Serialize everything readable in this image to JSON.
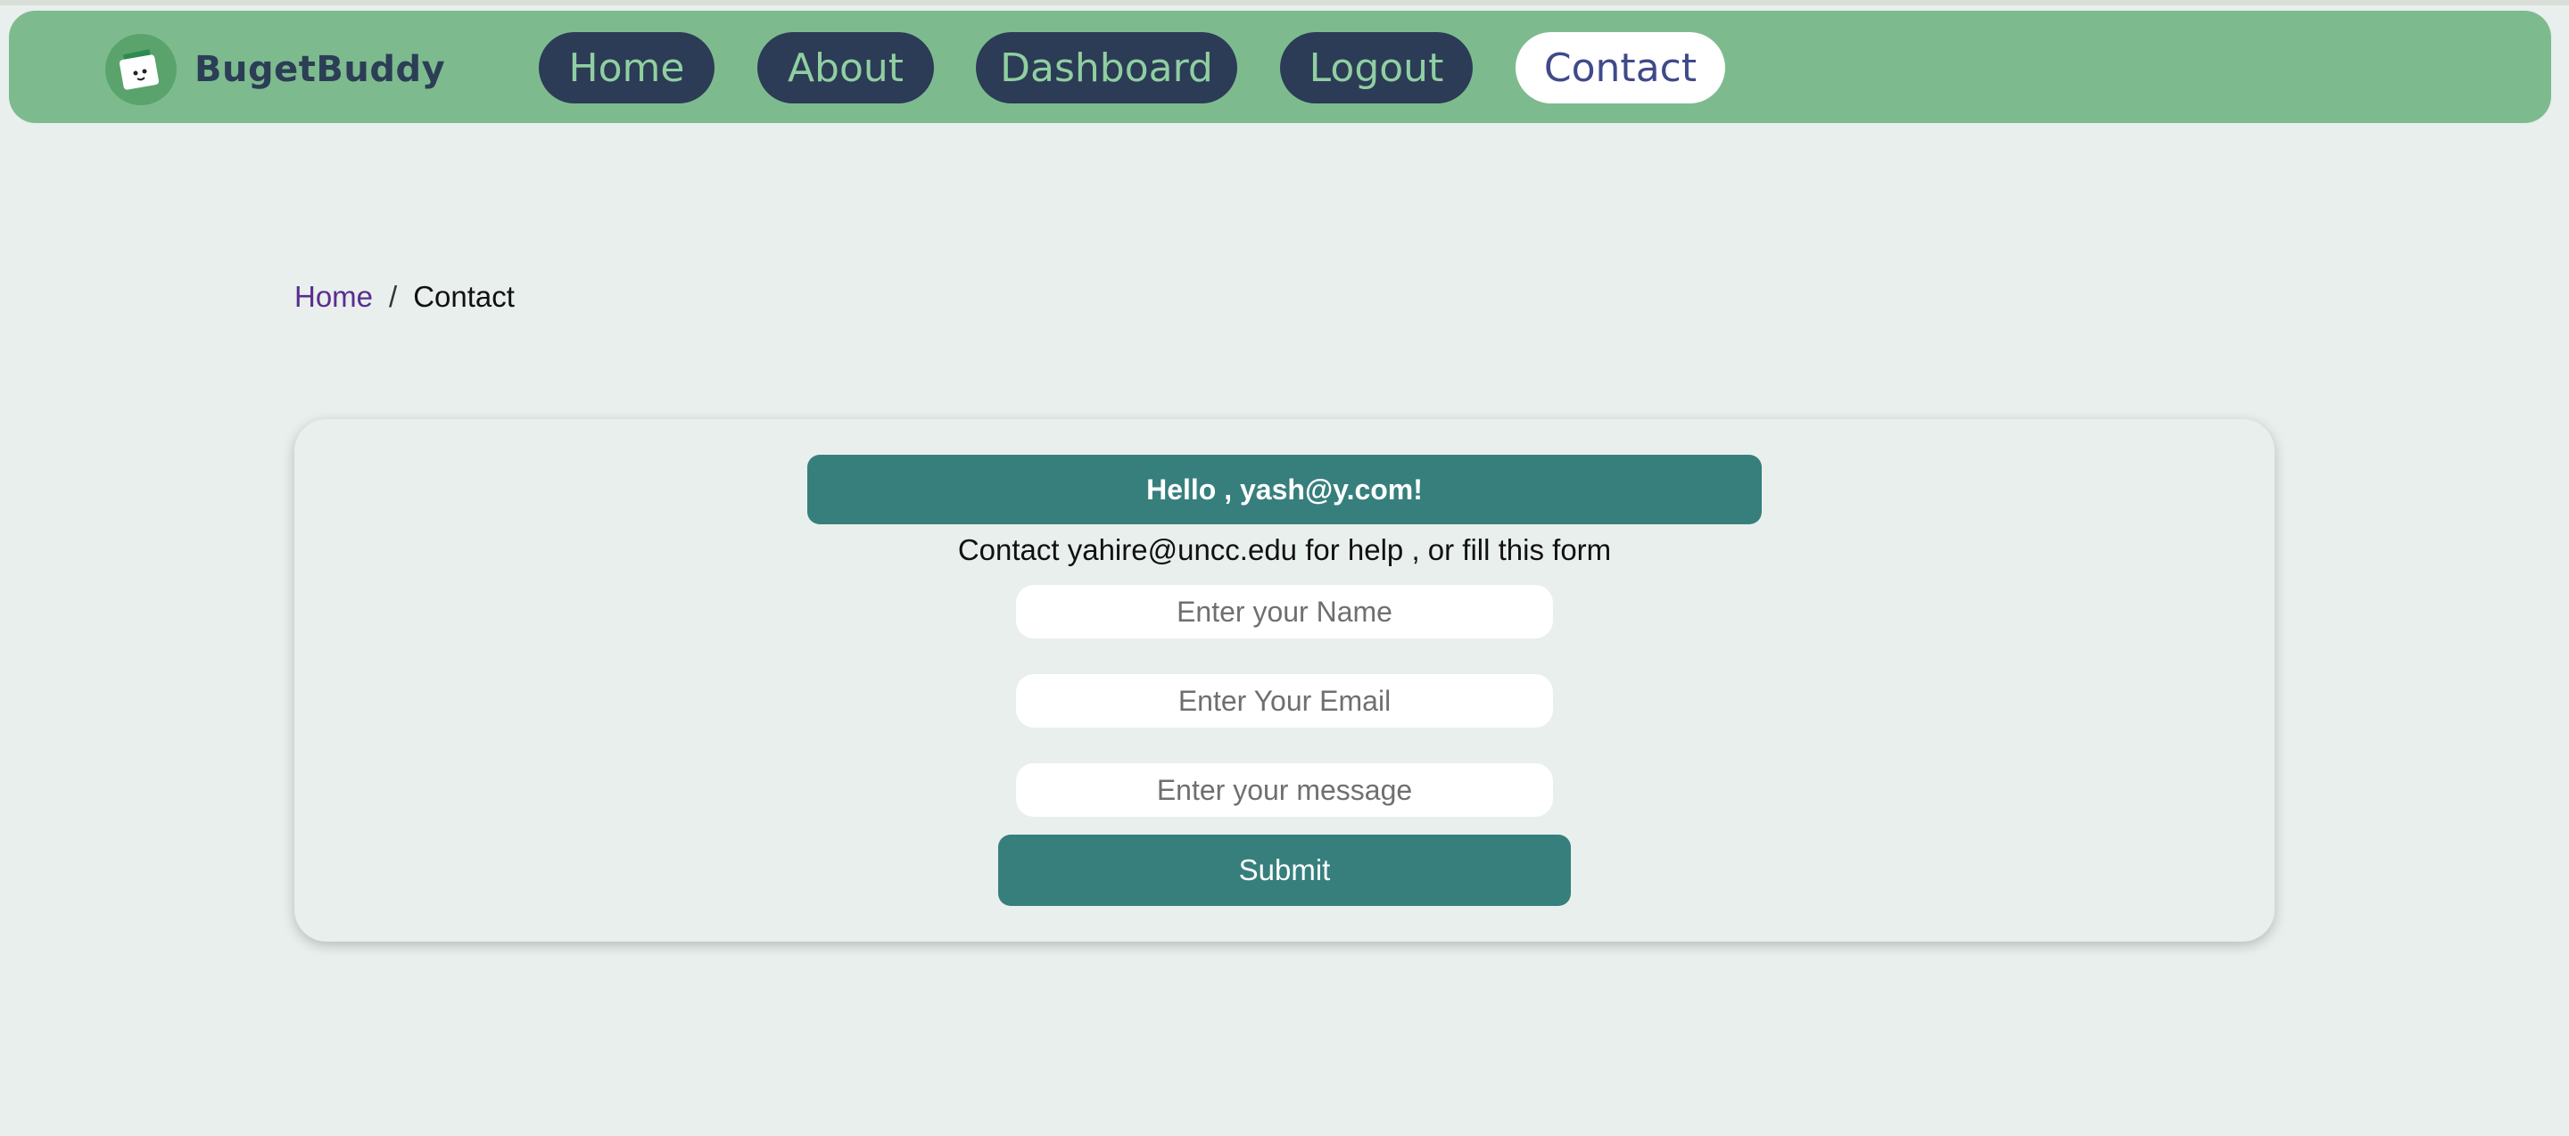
{
  "brand": {
    "name": "BugetBuddy",
    "logo_icon": "wallet-money-icon"
  },
  "nav": {
    "items": [
      {
        "label": "Home",
        "active": false
      },
      {
        "label": "About",
        "active": false
      },
      {
        "label": "Dashboard",
        "active": false
      },
      {
        "label": "Logout",
        "active": false
      },
      {
        "label": "Contact",
        "active": true
      }
    ]
  },
  "breadcrumb": {
    "home": "Home",
    "separator": "/",
    "current": "Contact"
  },
  "contact": {
    "greeting": "Hello , yash@y.com!",
    "help_text": "Contact yahire@uncc.edu for help , or fill this form",
    "name_placeholder": "Enter your Name",
    "email_placeholder": "Enter Your Email",
    "message_placeholder": "Enter your message",
    "submit_label": "Submit"
  },
  "colors": {
    "navbar": "#7dbb8f",
    "nav_button": "#2c3b56",
    "nav_text": "#8fcfa0",
    "accent": "#367f7d",
    "page_bg": "#e8efec"
  }
}
